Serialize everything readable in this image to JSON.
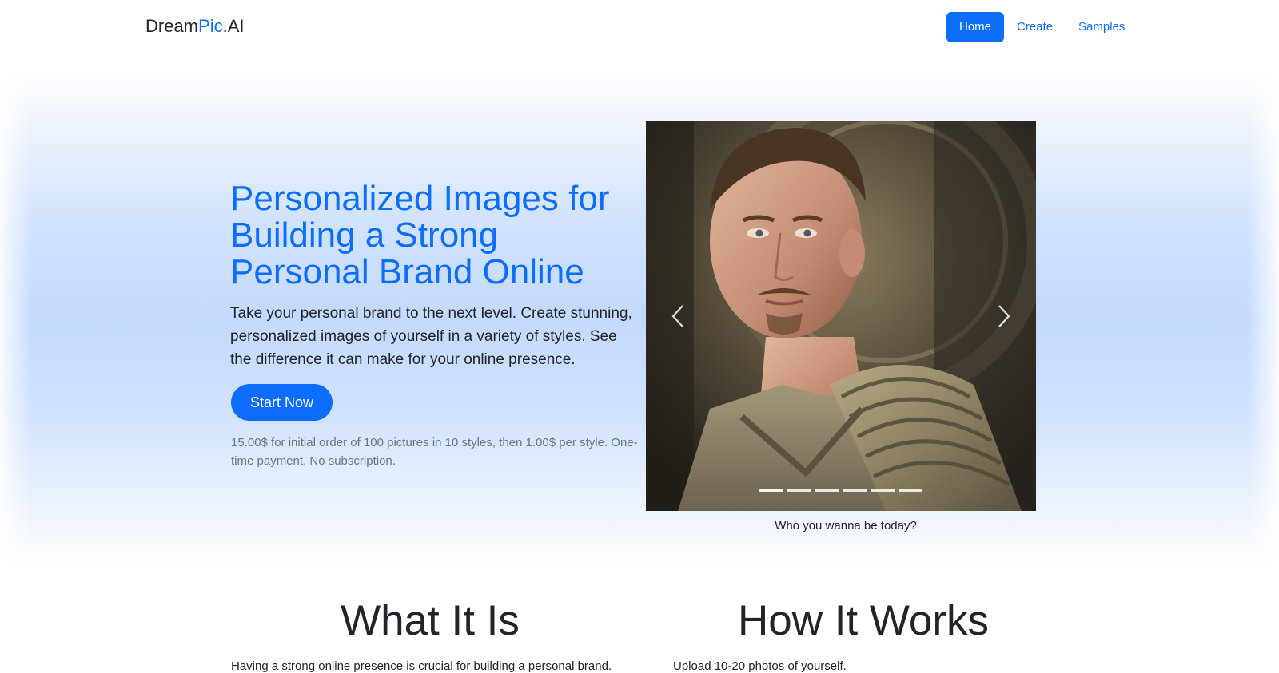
{
  "navbar": {
    "brand": {
      "prefix": "Dream",
      "accent": "Pic",
      "suffix": ".AI"
    },
    "links": [
      {
        "label": "Home",
        "active": true
      },
      {
        "label": "Create",
        "active": false
      },
      {
        "label": "Samples",
        "active": false
      }
    ]
  },
  "hero": {
    "title": "Personalized Images for Building a Strong Personal Brand Online",
    "lead": "Take your personal brand to the next level. Create stunning, personalized images of yourself in a variety of styles. See the difference it can make for your online presence.",
    "cta_label": "Start Now",
    "price_note": "15.00$ for initial order of 100 pictures in 10 styles, then 1.00$ per style. One-time payment. No subscription."
  },
  "carousel": {
    "caption": "Who you wanna be today?",
    "slide_count": 6,
    "active_slide": 1,
    "prev_icon": "chevron-left-icon",
    "next_icon": "chevron-right-icon"
  },
  "features": {
    "what_title": "What It Is",
    "what_text": "Having a strong online presence is crucial for building a personal brand.",
    "how_title": "How It Works",
    "how_text": "Upload 10-20 photos of yourself."
  },
  "colors": {
    "primary": "#0d6efd",
    "text": "#212529",
    "muted": "#6c757d"
  }
}
